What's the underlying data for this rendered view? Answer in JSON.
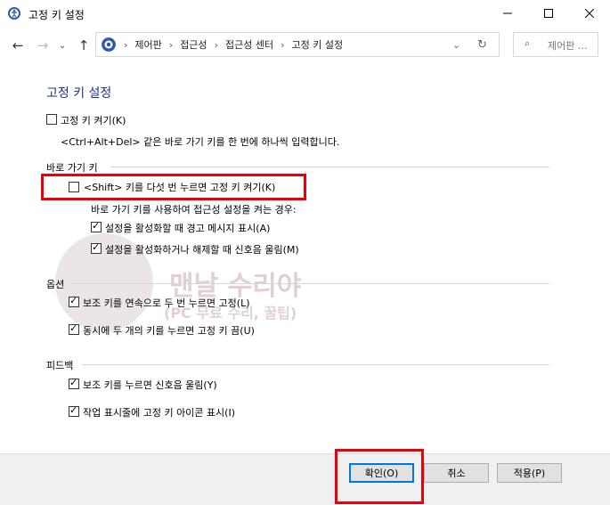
{
  "window": {
    "title": "고정 키 설정"
  },
  "nav": {
    "breadcrumbs": [
      "제어판",
      "접근성",
      "접근성 센터",
      "고정 키 설정"
    ],
    "search_placeholder": "제어판 ..."
  },
  "page": {
    "heading": "고정 키 설정",
    "toggle_label": "고정 키 켜기(K)",
    "toggle_checked": false,
    "description": "<Ctrl+Alt+Del> 같은 바로 가기 키를 한 번에 하나씩 입력합니다.",
    "shortcut_section": {
      "title": "바로 가기 키",
      "shift_label": "<Shift> 키를 다섯 번 누르면 고정 키 켜기(K)",
      "shift_checked": false,
      "note": "바로 가기 키를 사용하여 접근성 설정을 켜는 경우:",
      "warn_label": "설정을 활성화할 때 경고 메시지 표시(A)",
      "warn_checked": true,
      "sound_label": "설정을 활성화하거나 해제할 때 신호음 울림(M)",
      "sound_checked": true
    },
    "options_section": {
      "title": "옵션",
      "lock_label": "보조 키를 연속으로 두 번 누르면 고정(L)",
      "lock_checked": true,
      "off_label": "동시에 두 개의 키를 누르면 고정 키 끔(U)",
      "off_checked": true
    },
    "feedback_section": {
      "title": "피드백",
      "beep_label": "보조 키를 누르면 신호음 울림(Y)",
      "beep_checked": true,
      "taskbar_label": "작업 표시줄에 고정 키 아이콘 표시(I)",
      "taskbar_checked": true
    }
  },
  "watermark": {
    "line1": "맨날 수리야",
    "line2": "(PC 무료 수리, 꿀팁)"
  },
  "footer": {
    "ok": "확인(O)",
    "cancel": "취소",
    "apply": "적용(P)"
  },
  "colors": {
    "accent": "#1e3287",
    "highlight": "#e8000b",
    "focus": "#0078d7"
  }
}
